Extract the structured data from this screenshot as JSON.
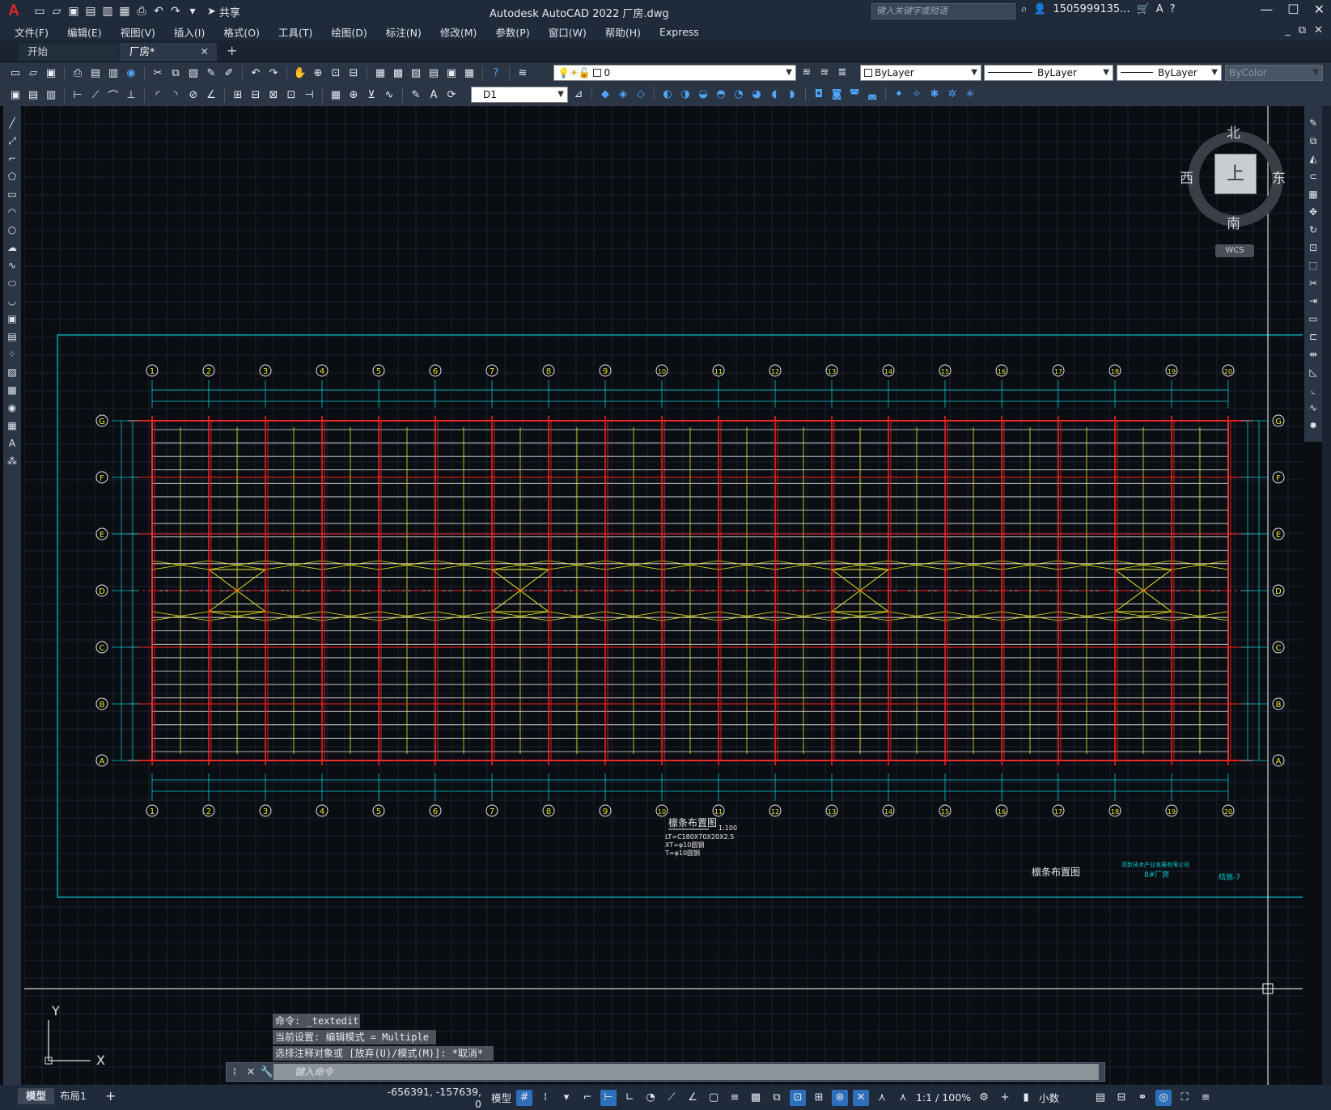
{
  "app": {
    "logo": "A",
    "title": "Autodesk AutoCAD 2022    厂房.dwg",
    "search_placeholder": "键入关键字或短语",
    "user": "1505999135...",
    "share_label": "共享"
  },
  "menu": [
    "文件(F)",
    "编辑(E)",
    "视图(V)",
    "插入(I)",
    "格式(O)",
    "工具(T)",
    "绘图(D)",
    "标注(N)",
    "修改(M)",
    "参数(P)",
    "窗口(W)",
    "帮助(H)",
    "Express"
  ],
  "tabs": {
    "start": "开始",
    "active": "厂房*",
    "add": "+"
  },
  "toolbar": {
    "layer_value": "0",
    "color_value": "ByLayer",
    "linetype_value": "ByLayer",
    "lineweight_value": "ByLayer",
    "plotstyle_value": "ByColor",
    "dimstyle_value": "D1"
  },
  "viewcube": {
    "north": "北",
    "south": "南",
    "east": "东",
    "west": "西",
    "top": "上",
    "wcs": "WCS"
  },
  "drawing": {
    "grid_cols": [
      "1",
      "2",
      "3",
      "4",
      "5",
      "6",
      "7",
      "8",
      "9",
      "10",
      "11",
      "12",
      "13",
      "14",
      "15",
      "16",
      "17",
      "18",
      "19",
      "20"
    ],
    "grid_rows": [
      "G",
      "F",
      "E",
      "D",
      "C",
      "B",
      "A"
    ],
    "title": "檩条布置图",
    "scale": "1:100",
    "notes": [
      "LT=C180X70X20X2.5",
      "XT=φ10圆钢",
      "T=φ10圆钢"
    ],
    "titleblock_name": "檩条布置图",
    "titleblock_company": "高新技术产业发展有限公司",
    "titleblock_project": "8#厂房",
    "titleblock_sheet": "结施-7"
  },
  "command": {
    "history": [
      "命令: _textedit",
      "当前设置: 编辑模式 = Multiple",
      "选择注释对象或 [放弃(U)/模式(M)]: *取消*"
    ],
    "placeholder": "键入命令"
  },
  "status": {
    "model_tab": "模型",
    "layout_tab": "布局1",
    "coords": "-656391, -157639, 0",
    "space": "模型",
    "scale": "1:1 / 100%",
    "units": "小数"
  },
  "colors": {
    "cyan": "#00c8d0",
    "red": "#ff2020",
    "yellow": "#e8e820",
    "white": "#e8e8e8",
    "background": "#0a0d12"
  }
}
